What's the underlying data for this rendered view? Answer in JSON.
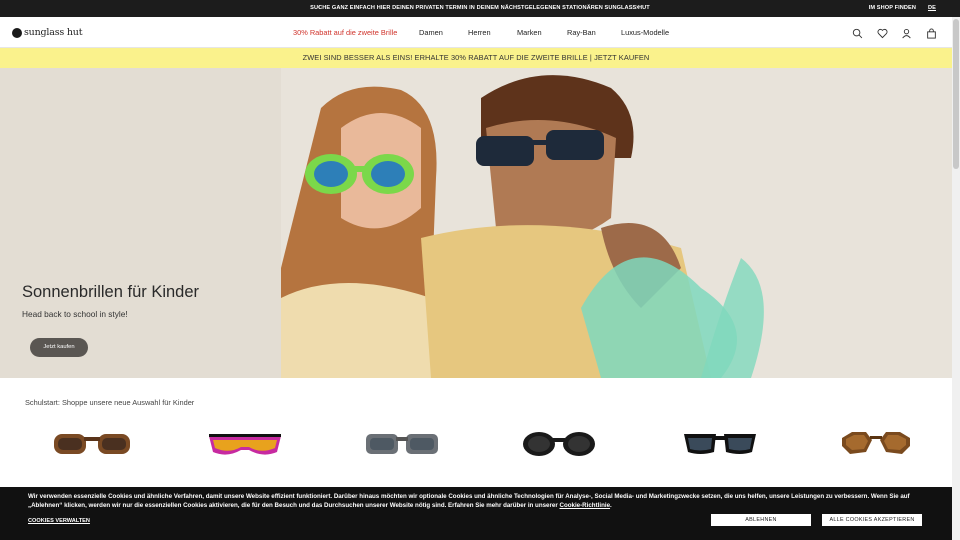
{
  "topbar": {
    "promo": "SUCHE GANZ EINFACH HIER DEINEN PRIVATEN TERMIN IN DEINEM NÄCHSTGELEGENEN STATIONÄREN SUNGLASS HUT",
    "prev_arrow": "‹",
    "next_arrow": "›",
    "store_finder": "IM SHOP FINDEN",
    "language": "DE"
  },
  "header": {
    "logo_text": "sunglass hut",
    "nav": [
      {
        "label": "30% Rabatt auf die zweite Brille"
      },
      {
        "label": "Damen"
      },
      {
        "label": "Herren"
      },
      {
        "label": "Marken"
      },
      {
        "label": "Ray-Ban"
      },
      {
        "label": "Luxus-Modelle"
      }
    ],
    "icons": [
      "search-icon",
      "heart-icon",
      "account-icon",
      "bag-icon"
    ]
  },
  "promo_banner": {
    "text": "ZWEI SIND BESSER ALS EINS! ERHALTE 30% RABATT AUF DIE ZWEITE BRILLE",
    "separator": "|",
    "link": "JETZT KAUFEN"
  },
  "hero": {
    "title": "Sonnenbrillen für Kinder",
    "subtitle": "Head back to school in style!",
    "cta": "Jetzt kaufen"
  },
  "products_section": {
    "title": "Schulstart: Shoppe unsere neue Auswahl für Kinder"
  },
  "cookie_banner": {
    "text": "Wir verwenden essenzielle Cookies und ähnliche Verfahren, damit unsere Website effizient funktioniert. Darüber hinaus möchten wir optionale Cookies und ähnliche Technologien für Analyse-, Social Media- und Marketingzwecke setzen, die uns helfen, unsere Leistungen zu verbessern. Wenn Sie auf „Ablehnen“ klicken, werden wir nur die essenziellen Cookies aktivieren, die für den Besuch und das Durchsuchen unserer Website nötig sind. Erfahren Sie mehr darüber in unserer",
    "link": "Cookie-Richtlinie",
    "link_suffix": ".",
    "manage": "COOKIES VERWALTEN",
    "reject": "ABLEHNEN",
    "accept": "ALLE COOKIES AKZEPTIEREN"
  },
  "colors": {
    "topbar": "#1c1c1c",
    "promo_yellow": "#faf28c",
    "sale_red": "#d0342c",
    "cta": "#5a5652",
    "cookie_bg": "#111111"
  }
}
